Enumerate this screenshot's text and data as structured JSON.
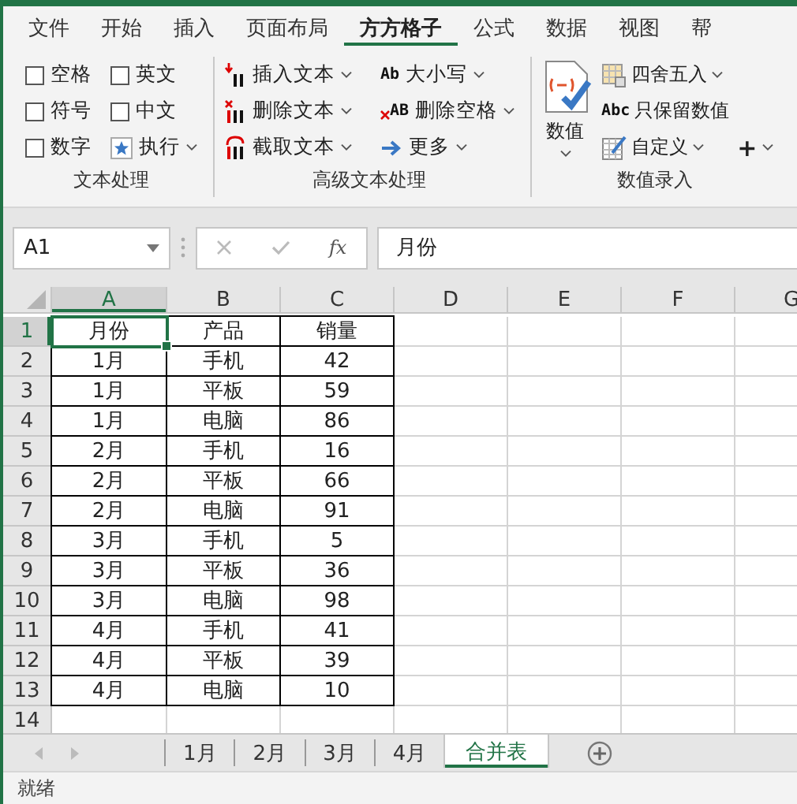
{
  "ribbon_tabs": [
    {
      "label": "文件",
      "selected": false
    },
    {
      "label": "开始",
      "selected": false
    },
    {
      "label": "插入",
      "selected": false
    },
    {
      "label": "页面布局",
      "selected": false
    },
    {
      "label": "方方格子",
      "selected": true
    },
    {
      "label": "公式",
      "selected": false
    },
    {
      "label": "数据",
      "selected": false
    },
    {
      "label": "视图",
      "selected": false
    },
    {
      "label": "帮",
      "selected": false
    }
  ],
  "ribbon": {
    "groups": [
      {
        "title": "文本处理",
        "items": [
          {
            "kind": "checkbox",
            "label": "空格",
            "checked": false
          },
          {
            "kind": "checkbox",
            "label": "英文",
            "checked": false
          },
          {
            "kind": "checkbox",
            "label": "符号",
            "checked": false
          },
          {
            "kind": "checkbox",
            "label": "中文",
            "checked": false
          },
          {
            "kind": "checkbox",
            "label": "数字",
            "checked": false
          },
          {
            "kind": "dropdown",
            "label": "执行"
          }
        ]
      },
      {
        "title": "高级文本处理",
        "items": [
          {
            "kind": "dropdown",
            "label": "插入文本"
          },
          {
            "kind": "dropdown",
            "label": "删除文本"
          },
          {
            "kind": "dropdown",
            "label": "截取文本"
          },
          {
            "kind": "dropdown",
            "label": "大小写",
            "icon_text": "Ab"
          },
          {
            "kind": "dropdown",
            "label": "删除空格",
            "icon_text": "AB"
          },
          {
            "kind": "dropdown",
            "label": "更多"
          }
        ]
      },
      {
        "title": "数值录入",
        "items": [
          {
            "kind": "large-dropdown",
            "label": "数值"
          },
          {
            "kind": "dropdown",
            "label": "四舍五入"
          },
          {
            "kind": "button",
            "label": "只保留数值",
            "icon_text": "Abc"
          },
          {
            "kind": "dropdown",
            "label": "自定义"
          },
          {
            "kind": "dropdown",
            "label": "+"
          }
        ]
      }
    ]
  },
  "formula_bar": {
    "name_box": "A1",
    "function_label": "fx",
    "value": "月份"
  },
  "sheet": {
    "columns": [
      {
        "label": "A",
        "selected": true
      },
      {
        "label": "B",
        "selected": false
      },
      {
        "label": "C",
        "selected": false
      },
      {
        "label": "D",
        "selected": false
      },
      {
        "label": "E",
        "selected": false
      },
      {
        "label": "F",
        "selected": false
      },
      {
        "label": "G",
        "selected": false
      }
    ],
    "rows": [
      {
        "label": "1",
        "selected": true,
        "cells": [
          {
            "text": "月份",
            "selected": true
          },
          {
            "text": "产品",
            "selected": false
          },
          {
            "text": "销量",
            "selected": false
          }
        ]
      },
      {
        "label": "2",
        "selected": false,
        "cells": [
          {
            "text": "1月",
            "selected": false
          },
          {
            "text": "手机",
            "selected": false
          },
          {
            "text": "42",
            "selected": false
          }
        ]
      },
      {
        "label": "3",
        "selected": false,
        "cells": [
          {
            "text": "1月",
            "selected": false
          },
          {
            "text": "平板",
            "selected": false
          },
          {
            "text": "59",
            "selected": false
          }
        ]
      },
      {
        "label": "4",
        "selected": false,
        "cells": [
          {
            "text": "1月",
            "selected": false
          },
          {
            "text": "电脑",
            "selected": false
          },
          {
            "text": "86",
            "selected": false
          }
        ]
      },
      {
        "label": "5",
        "selected": false,
        "cells": [
          {
            "text": "2月",
            "selected": false
          },
          {
            "text": "手机",
            "selected": false
          },
          {
            "text": "16",
            "selected": false
          }
        ]
      },
      {
        "label": "6",
        "selected": false,
        "cells": [
          {
            "text": "2月",
            "selected": false
          },
          {
            "text": "平板",
            "selected": false
          },
          {
            "text": "66",
            "selected": false
          }
        ]
      },
      {
        "label": "7",
        "selected": false,
        "cells": [
          {
            "text": "2月",
            "selected": false
          },
          {
            "text": "电脑",
            "selected": false
          },
          {
            "text": "91",
            "selected": false
          }
        ]
      },
      {
        "label": "8",
        "selected": false,
        "cells": [
          {
            "text": "3月",
            "selected": false
          },
          {
            "text": "手机",
            "selected": false
          },
          {
            "text": "5",
            "selected": false
          }
        ]
      },
      {
        "label": "9",
        "selected": false,
        "cells": [
          {
            "text": "3月",
            "selected": false
          },
          {
            "text": "平板",
            "selected": false
          },
          {
            "text": "36",
            "selected": false
          }
        ]
      },
      {
        "label": "10",
        "selected": false,
        "cells": [
          {
            "text": "3月",
            "selected": false
          },
          {
            "text": "电脑",
            "selected": false
          },
          {
            "text": "98",
            "selected": false
          }
        ]
      },
      {
        "label": "11",
        "selected": false,
        "cells": [
          {
            "text": "4月",
            "selected": false
          },
          {
            "text": "手机",
            "selected": false
          },
          {
            "text": "41",
            "selected": false
          }
        ]
      },
      {
        "label": "12",
        "selected": false,
        "cells": [
          {
            "text": "4月",
            "selected": false
          },
          {
            "text": "平板",
            "selected": false
          },
          {
            "text": "39",
            "selected": false
          }
        ]
      },
      {
        "label": "13",
        "selected": false,
        "cells": [
          {
            "text": "4月",
            "selected": false
          },
          {
            "text": "电脑",
            "selected": false
          },
          {
            "text": "10",
            "selected": false
          }
        ]
      },
      {
        "label": "14",
        "selected": false,
        "cells": []
      }
    ]
  },
  "sheet_tabs": [
    {
      "label": "1月",
      "selected": false
    },
    {
      "label": "2月",
      "selected": false
    },
    {
      "label": "3月",
      "selected": false
    },
    {
      "label": "4月",
      "selected": false
    },
    {
      "label": "合并表",
      "selected": true
    }
  ],
  "status_bar": {
    "text": "就绪"
  }
}
